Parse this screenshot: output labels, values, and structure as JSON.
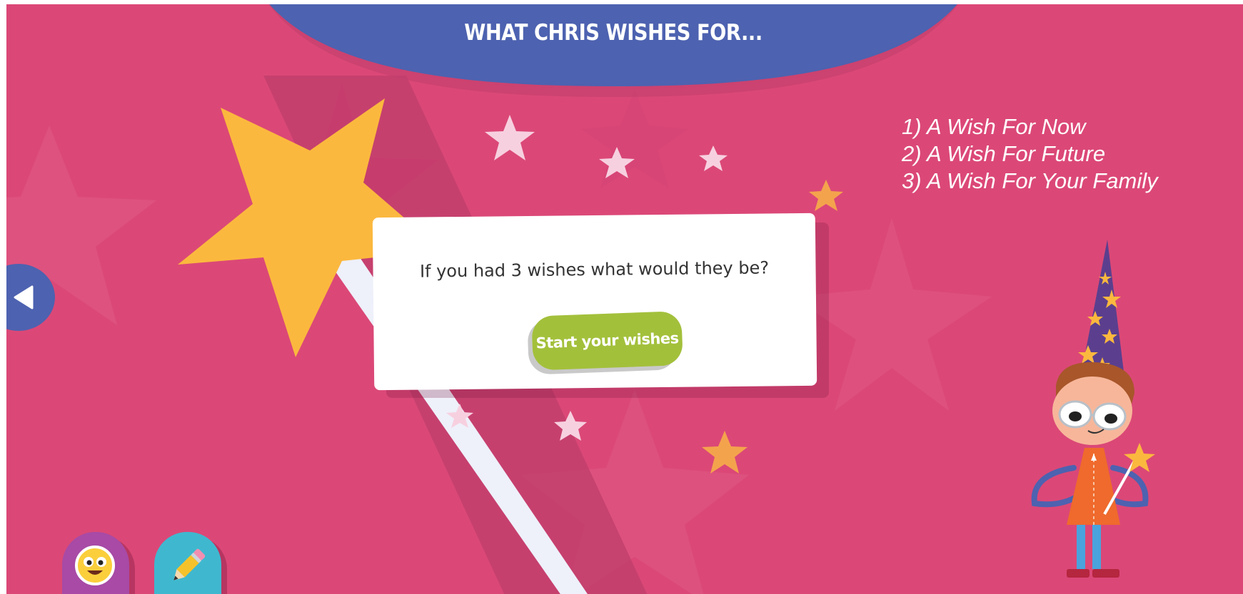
{
  "header": {
    "title": "WHAT CHRIS WISHES FOR..."
  },
  "wish_list": {
    "items": [
      "1) A Wish For Now",
      "2) A Wish For Future",
      "3) A Wish For Your Family"
    ]
  },
  "dialog": {
    "question": "If you had 3 wishes what would they be?",
    "start_button": "Start your wishes"
  },
  "icons": {
    "back": "back-arrow-icon",
    "emoji": "smiley-face-icon",
    "pencil": "pencil-icon",
    "wand": "magic-wand-star",
    "character": "wizard-boy-chris"
  },
  "colors": {
    "background": "#db4877",
    "header": "#4d62b0",
    "start_button": "#a3c03b",
    "star_yellow": "#fbb83e",
    "emoji_button": "#a84aa6",
    "pencil_button": "#3fb8cf"
  }
}
